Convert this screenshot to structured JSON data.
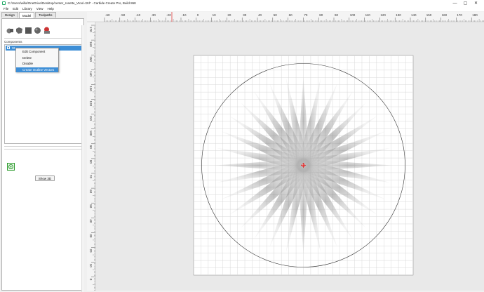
{
  "window": {
    "title": "C:/Users/willa/OneDrive/Desktop/center_rosette_Vtool.c2d* - Carbide Create Pro, Build 868",
    "minimize": "—",
    "maximize": "▢",
    "close": "✕"
  },
  "menu": [
    "File",
    "Edit",
    "Library",
    "View",
    "Help"
  ],
  "tabs": [
    "Design",
    "Model",
    "Toolpaths"
  ],
  "active_tab": "Model",
  "components_label": "Components",
  "component_row_label": "St",
  "context_menu": {
    "items": [
      "Edit Component",
      "Delete",
      "Disable",
      "Create Outline Vectors"
    ],
    "highlighted": "Create Outline Vectors"
  },
  "show3d_label": "Show 3D",
  "ruler": {
    "top_labels": [
      "-60",
      "-50",
      "-40",
      "-30",
      "-20",
      "-10",
      "0",
      "10",
      "20",
      "30",
      "40",
      "50",
      "60",
      "70",
      "80",
      "90",
      "100",
      "110",
      "120",
      "130",
      "140",
      "150",
      "160",
      "170",
      "180",
      "190"
    ],
    "left_labels": [
      "170",
      "160",
      "150",
      "140",
      "130",
      "120",
      "110",
      "100",
      "90",
      "80",
      "70",
      "60",
      "50",
      "40",
      "30",
      "20",
      "10",
      "0"
    ]
  },
  "colors": {
    "selection": "#3d8ed6",
    "ruler_marker": "#e04040",
    "origin_marker": "#e02020",
    "grid": "#d8d8d8",
    "circle": "#333333"
  }
}
